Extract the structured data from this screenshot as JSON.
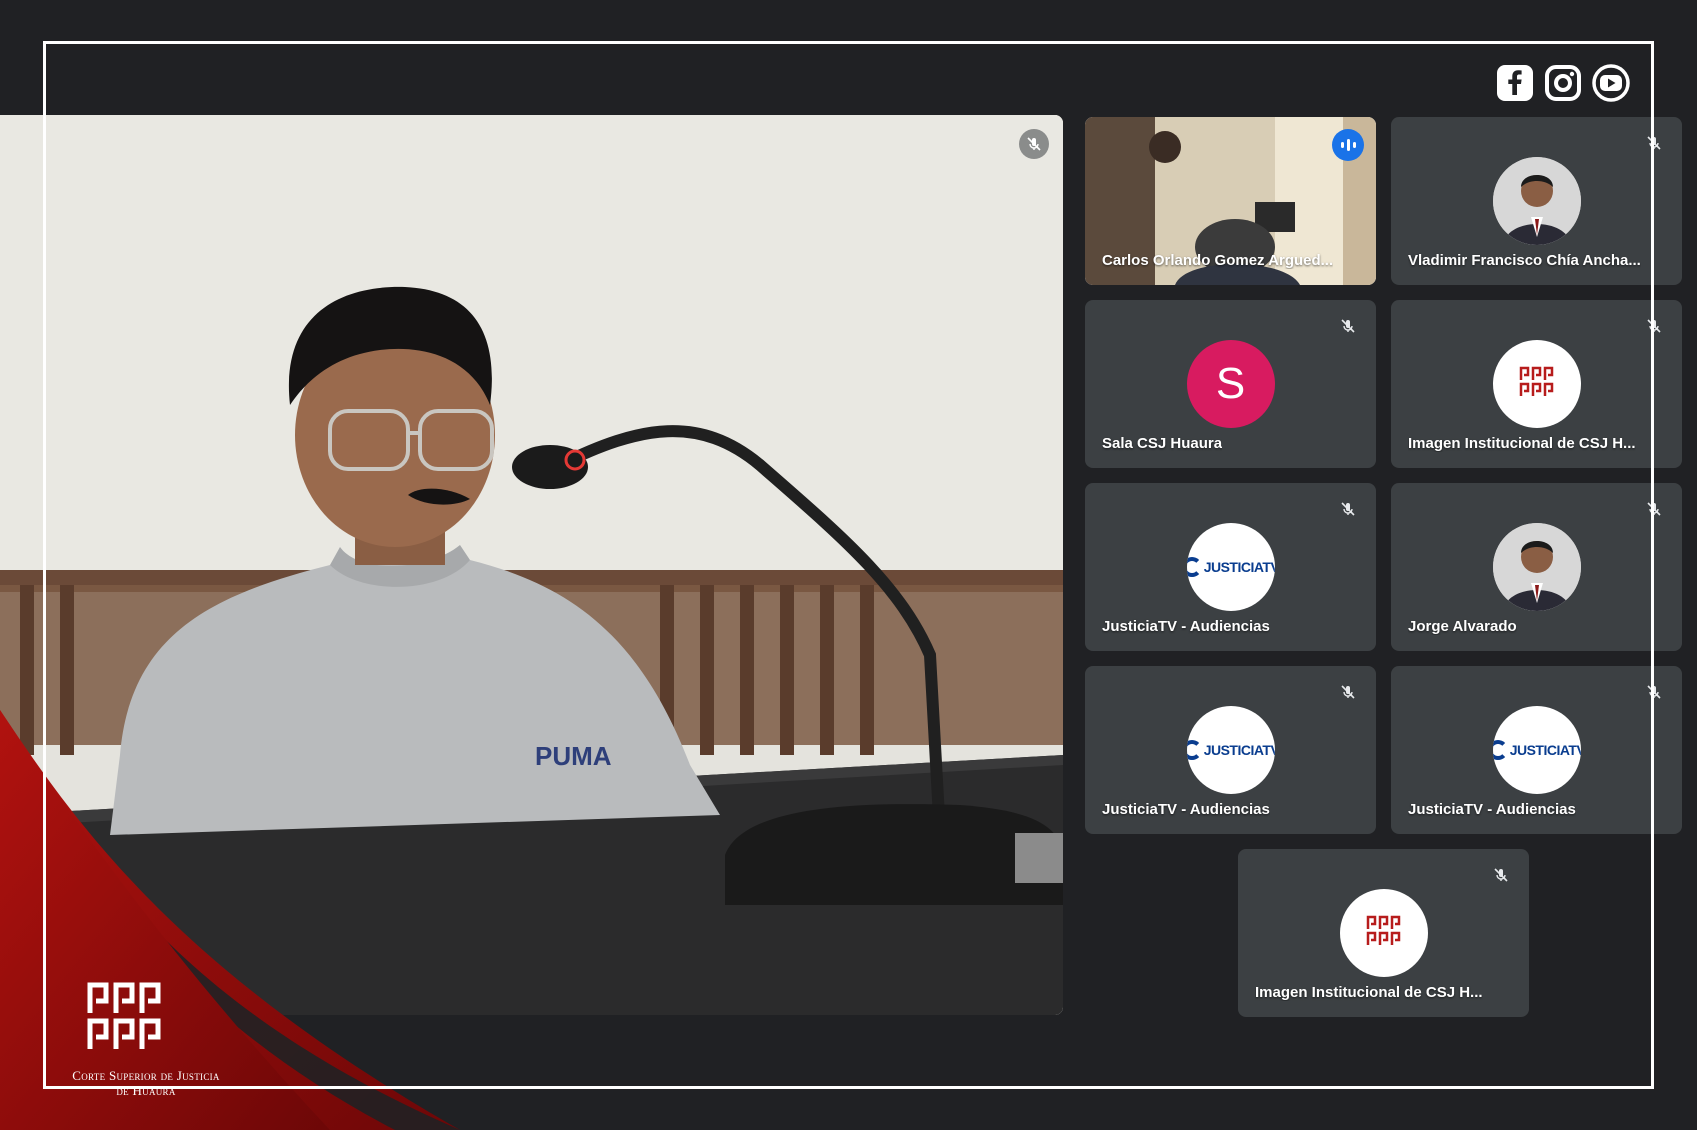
{
  "social": {
    "icons": [
      "facebook-icon",
      "instagram-icon",
      "youtube-icon"
    ]
  },
  "colors": {
    "background": "#202124",
    "tile": "#3c4043",
    "active_outline": "#8ab4f8",
    "speaking": "#1a73e8",
    "avatar_s": "#d81b60",
    "brand_red": "#8b0b0b"
  },
  "tiles": [
    {
      "name": "Carlos Orlando Gomez Argued...",
      "avatar": "video",
      "speaking": true
    },
    {
      "name": "Vladimir Francisco Chía Ancha...",
      "avatar": "photo"
    },
    {
      "name": "Sala CSJ Huaura",
      "avatar": "letter",
      "letter": "S"
    },
    {
      "name": "Imagen Institucional de CSJ H...",
      "avatar": "logo"
    },
    {
      "name": "JusticiaTV - Audiencias",
      "avatar": "justiciatv",
      "logo_text": "JUSTICIATV"
    },
    {
      "name": "Jorge Alvarado",
      "avatar": "photo"
    },
    {
      "name": "JusticiaTV - Audiencias",
      "avatar": "justiciatv",
      "logo_text": "JUSTICIATV"
    },
    {
      "name": "JusticiaTV - Audiencias",
      "avatar": "justiciatv",
      "logo_text": "JUSTICIATV"
    },
    {
      "name": "Imagen Institucional de CSJ H...",
      "avatar": "logo"
    }
  ],
  "brand": {
    "line1": "Corte Superior de Justicia",
    "line2": "de Huaura"
  }
}
